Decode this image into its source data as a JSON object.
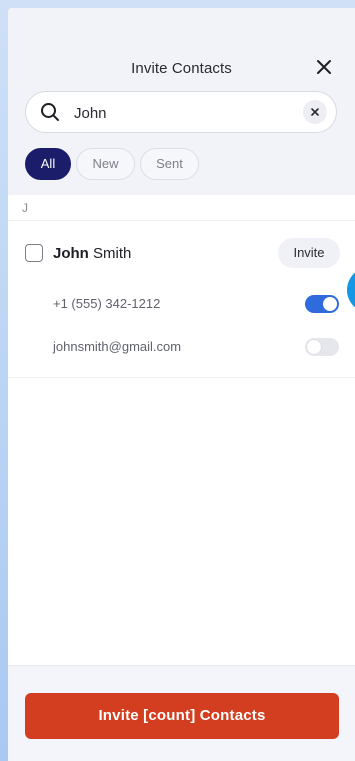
{
  "header": {
    "title": "Invite Contacts",
    "close_icon": "close-icon"
  },
  "search": {
    "value": "John",
    "placeholder": "",
    "icon": "search-icon",
    "clear_icon": "clear-icon"
  },
  "filters": [
    {
      "label": "All",
      "active": true
    },
    {
      "label": "New",
      "active": false
    },
    {
      "label": "Sent",
      "active": false
    }
  ],
  "sections": [
    {
      "letter": "J",
      "contacts": [
        {
          "first_name": "John",
          "last_name": " Smith",
          "checked": false,
          "invite_label": "Invite",
          "details": [
            {
              "value": "+1 (555) 342-1212",
              "enabled": true
            },
            {
              "value": "johnsmith@gmail.com",
              "enabled": false
            }
          ]
        }
      ]
    }
  ],
  "footer": {
    "cta_label": "Invite [count] Contacts"
  },
  "colors": {
    "accent": "#1b1c6a",
    "cta": "#d23e1f",
    "toggle_on": "#2f6bdc",
    "touch_indicator": "#1597e5"
  }
}
